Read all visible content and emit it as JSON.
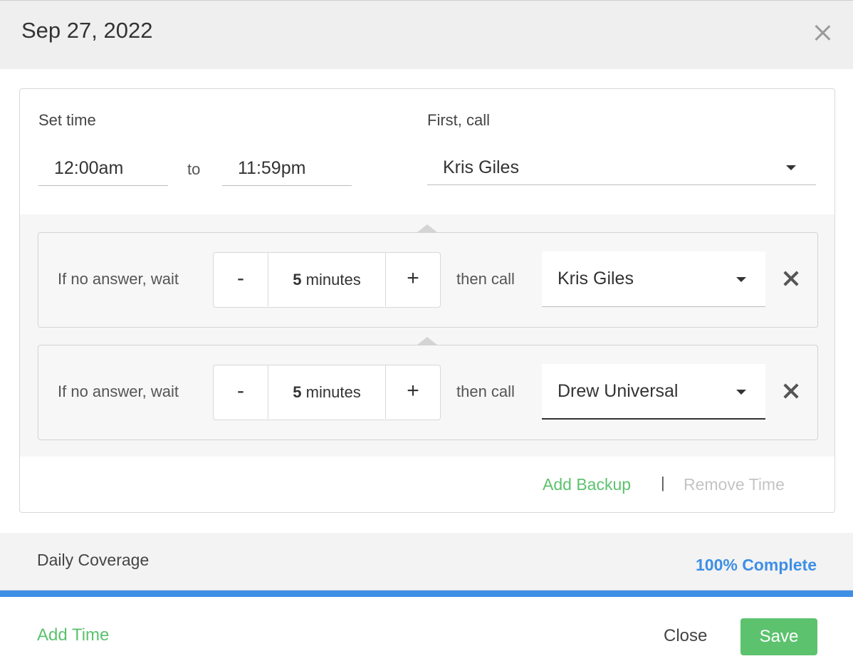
{
  "header": {
    "title": "Sep 27, 2022",
    "close_icon": "close-icon"
  },
  "time_block": {
    "set_time_label": "Set time",
    "start_time": "12:00am",
    "to_label": "to",
    "end_time": "11:59pm",
    "first_call_label": "First, call",
    "first_call_value": "Kris Giles"
  },
  "backups": [
    {
      "wait_label": "If no answer, wait",
      "minus": "-",
      "wait_value": "5",
      "wait_unit": "minutes",
      "plus": "+",
      "then_label": "then call",
      "call_value": "Kris Giles"
    },
    {
      "wait_label": "If no answer, wait",
      "minus": "-",
      "wait_value": "5",
      "wait_unit": "minutes",
      "plus": "+",
      "then_label": "then call",
      "call_value": "Drew Universal"
    }
  ],
  "actions": {
    "add_backup": "Add Backup",
    "separator": "|",
    "remove_time": "Remove Time"
  },
  "coverage": {
    "label": "Daily Coverage",
    "percent_text": "100% Complete",
    "progress": 1.0
  },
  "footer": {
    "add_time": "Add Time",
    "close": "Close",
    "save": "Save"
  },
  "colors": {
    "accent_green": "#5cc26e",
    "accent_blue": "#3d8fe6"
  }
}
